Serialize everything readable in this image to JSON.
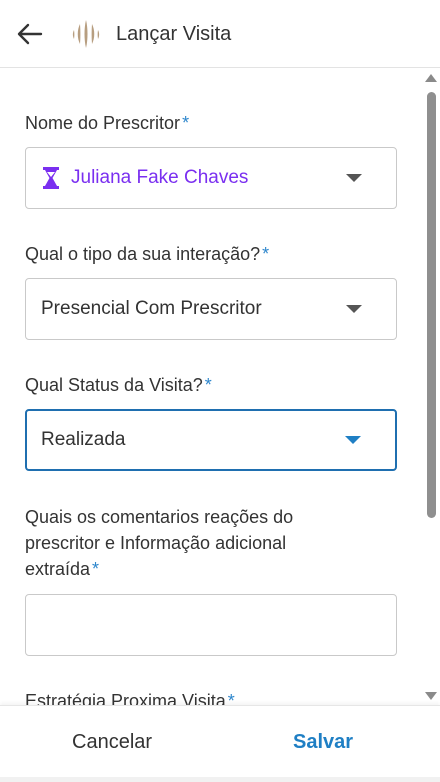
{
  "header": {
    "title": "Lançar Visita",
    "back_icon": "arrow-left-icon",
    "logo_icon": "brand-logo-icon",
    "logo_color": "#b79e80"
  },
  "form": {
    "prescritor": {
      "label": "Nome do Prescritor",
      "required_mark": "*",
      "value": "Juliana Fake Chaves",
      "icon": "hourglass-icon",
      "value_color": "#7a2ff0"
    },
    "interacao": {
      "label": "Qual o tipo da sua interação?",
      "required_mark": "*",
      "value": "Presencial Com Prescritor"
    },
    "status": {
      "label": "Qual Status da Visita?",
      "required_mark": "*",
      "value": "Realizada"
    },
    "comentarios": {
      "label_line1": "Quais os comentarios reações do",
      "label_line2": "prescritor e Informação adicional",
      "label_line3": "extraída",
      "required_mark": "*",
      "value": ""
    },
    "estrategia": {
      "label": "Estratégia Proxima Visita",
      "required_mark": "*"
    }
  },
  "footer": {
    "cancel_label": "Cancelar",
    "save_label": "Salvar"
  },
  "colors": {
    "accent": "#1f7fc4",
    "required": "#2d86cc",
    "text": "#333333"
  }
}
